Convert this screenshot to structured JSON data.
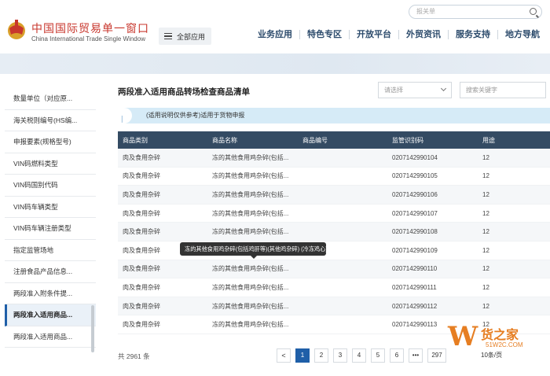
{
  "header": {
    "logo_cn": "中国国际贸易单一窗口",
    "logo_en": "China International Trade Single Window",
    "all_apps": "全部应用",
    "search_placeholder": "报关单",
    "nav": [
      "业务应用",
      "特色专区",
      "开放平台",
      "外贸资讯",
      "服务支持",
      "地方导航"
    ]
  },
  "sidebar": {
    "items": [
      "数量单位（对应原...",
      "海关税则编号(HS编...",
      "申报要素(规格型号)",
      "VIN码燃料类型",
      "VIN码国别代码",
      "VIN码车辆类型",
      "VIN码车辆注册类型",
      "指定监管场地",
      "注册食品产品信息...",
      "两段准入附条件提...",
      "两段准入适用商品...",
      "两段准入适用商品..."
    ],
    "active_index": 10
  },
  "main": {
    "title": "两段准入适用商品转场检查商品清单",
    "select_placeholder": "请选择",
    "keyword_placeholder": "搜索关键字",
    "notice": "(适用说明仅供参考)适用于货物申报",
    "columns": [
      "商品类别",
      "商品名称",
      "商品编号",
      "监管识别码",
      "用途"
    ],
    "rows": [
      [
        "肉及食用杂碎",
        "冻的其他食用鸡杂碎(包括...",
        "",
        "0207142990104",
        "12"
      ],
      [
        "肉及食用杂碎",
        "冻的其他食用鸡杂碎(包括...",
        "",
        "0207142990105",
        "12"
      ],
      [
        "肉及食用杂碎",
        "冻的其他食用鸡杂碎(包括...",
        "",
        "0207142990106",
        "12"
      ],
      [
        "肉及食用杂碎",
        "冻的其他食用鸡杂碎(包括...",
        "",
        "0207142990107",
        "12"
      ],
      [
        "肉及食用杂碎",
        "冻的其他食用鸡杂碎(包括...",
        "",
        "0207142990108",
        "12"
      ],
      [
        "肉及食用杂碎",
        "",
        "",
        "0207142990109",
        "12"
      ],
      [
        "肉及食用杂碎",
        "冻的其他食用鸡杂碎(包括...",
        "",
        "0207142990110",
        "12"
      ],
      [
        "肉及食用杂碎",
        "冻的其他食用鸡杂碎(包括...",
        "",
        "0207142990111",
        "12"
      ],
      [
        "肉及食用杂碎",
        "冻的其他食用鸡杂碎(包括...",
        "",
        "0207142990112",
        "12"
      ],
      [
        "肉及食用杂碎",
        "冻的其他食用鸡杂碎(包括...",
        "",
        "0207142990113",
        "12"
      ]
    ],
    "tooltip": "冻的其他食用鸡杂碎(包括鸡肝等)(其他鸡杂碎) (冷冻鸡心)",
    "total": "共 2961 条",
    "pager": {
      "prev": "<",
      "pages": [
        "1",
        "2",
        "3",
        "4",
        "5",
        "6",
        "•••",
        "297"
      ],
      "current": "1",
      "page_size": "10条/页"
    }
  },
  "watermark": {
    "letter": "W",
    "text": "货之家",
    "url": "51W2C.COM"
  }
}
